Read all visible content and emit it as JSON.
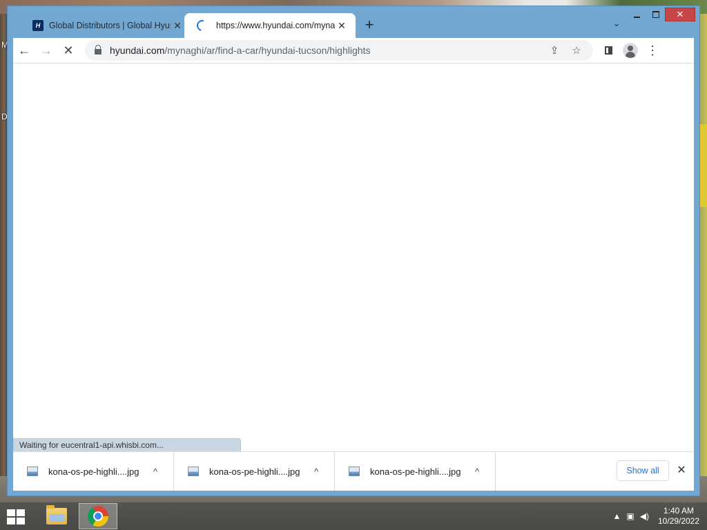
{
  "window": {
    "controls": {
      "minimize": "—",
      "maximize": "",
      "close": "✕"
    }
  },
  "tabs": [
    {
      "title": "Global Distributors | Global Hyundai",
      "close": "✕",
      "favicon": "H"
    },
    {
      "title": "https://www.hyundai.com/mynaghi/ar/find-a-car/hyundai-tucson/highlights",
      "close": "✕",
      "loading": true
    }
  ],
  "tabstrip": {
    "new_tab": "+",
    "tab_search": "⌄"
  },
  "toolbar": {
    "back": "←",
    "forward": "→",
    "stop": "✕",
    "url_host": "hyundai.com",
    "url_path": "/mynaghi/ar/find-a-car/hyundai-tucson/highlights",
    "share_icon": "⇪",
    "star_icon": "☆",
    "menu_icon": "⋮"
  },
  "status_text": "Waiting for eucentral1-api.whisbi.com...",
  "downloads": {
    "items": [
      {
        "name": "kona-os-pe-highli....jpg"
      },
      {
        "name": "kona-os-pe-highli....jpg"
      },
      {
        "name": "kona-os-pe-highli....jpg"
      }
    ],
    "chevron": "^",
    "show_all": "Show all",
    "close": "✕"
  },
  "desktop": {
    "letter1": "M",
    "letter2": "D"
  },
  "taskbar": {
    "tray_arrow": "▲",
    "time": "1:40 AM",
    "date": "10/29/2022"
  },
  "colors": {
    "window_frame": "#72a7d1",
    "close_button": "#c94646",
    "link_blue": "#1a73e8"
  }
}
